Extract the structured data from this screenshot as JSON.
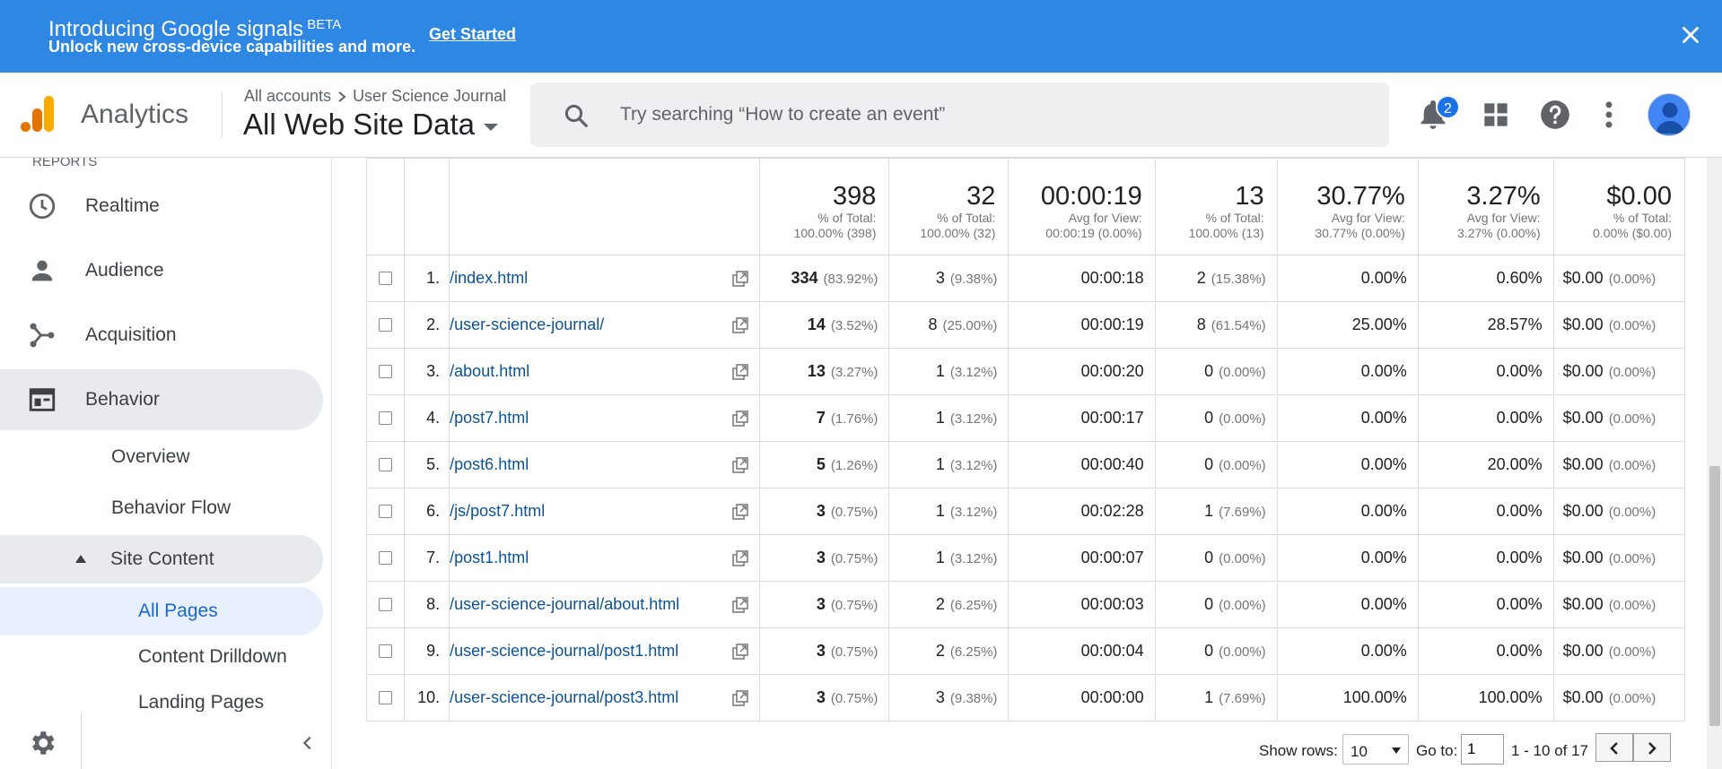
{
  "banner": {
    "title": "Introducing Google signals",
    "beta": "BETA",
    "subtitle": "Unlock new cross-device capabilities and more.",
    "cta": "Get Started"
  },
  "header": {
    "app_name": "Analytics",
    "breadcrumb_account": "All accounts",
    "breadcrumb_property": "User Science Journal",
    "view": "All Web Site Data",
    "search_placeholder": "Try searching “How to create an event”",
    "notification_count": "2"
  },
  "sidebar": {
    "section_label": "REPORTS",
    "items": [
      {
        "label": "Realtime",
        "icon": "clock-icon"
      },
      {
        "label": "Audience",
        "icon": "person-icon"
      },
      {
        "label": "Acquisition",
        "icon": "acquisition-icon"
      },
      {
        "label": "Behavior",
        "icon": "behavior-icon"
      }
    ],
    "behavior_sub": [
      "Overview",
      "Behavior Flow"
    ],
    "site_content": "Site Content",
    "site_content_items": [
      "All Pages",
      "Content Drilldown",
      "Landing Pages"
    ]
  },
  "totals": [
    {
      "big": "398",
      "line1": "% of Total:",
      "line2": "100.00% (398)"
    },
    {
      "big": "32",
      "line1": "% of Total:",
      "line2": "100.00% (32)"
    },
    {
      "big": "00:00:19",
      "line1": "Avg for View:",
      "line2": "00:00:19 (0.00%)"
    },
    {
      "big": "13",
      "line1": "% of Total:",
      "line2": "100.00% (13)"
    },
    {
      "big": "30.77%",
      "line1": "Avg for View:",
      "line2": "30.77% (0.00%)"
    },
    {
      "big": "3.27%",
      "line1": "Avg for View:",
      "line2": "3.27% (0.00%)"
    },
    {
      "big": "$0.00",
      "line1": "% of Total:",
      "line2": "0.00% ($0.00)"
    }
  ],
  "rows": [
    {
      "idx": "1.",
      "page": "/index.html",
      "pv": "334",
      "pv_pct": "(83.92%)",
      "upv": "3",
      "upv_pct": "(9.38%)",
      "time": "00:00:18",
      "ent": "2",
      "ent_pct": "(15.38%)",
      "bounce": "0.00%",
      "exit": "0.60%",
      "value": "$0.00",
      "value_pct": "(0.00%)"
    },
    {
      "idx": "2.",
      "page": "/user-science-journal/",
      "pv": "14",
      "pv_pct": "(3.52%)",
      "upv": "8",
      "upv_pct": "(25.00%)",
      "time": "00:00:19",
      "ent": "8",
      "ent_pct": "(61.54%)",
      "bounce": "25.00%",
      "exit": "28.57%",
      "value": "$0.00",
      "value_pct": "(0.00%)"
    },
    {
      "idx": "3.",
      "page": "/about.html",
      "pv": "13",
      "pv_pct": "(3.27%)",
      "upv": "1",
      "upv_pct": "(3.12%)",
      "time": "00:00:20",
      "ent": "0",
      "ent_pct": "(0.00%)",
      "bounce": "0.00%",
      "exit": "0.00%",
      "value": "$0.00",
      "value_pct": "(0.00%)"
    },
    {
      "idx": "4.",
      "page": "/post7.html",
      "pv": "7",
      "pv_pct": "(1.76%)",
      "upv": "1",
      "upv_pct": "(3.12%)",
      "time": "00:00:17",
      "ent": "0",
      "ent_pct": "(0.00%)",
      "bounce": "0.00%",
      "exit": "0.00%",
      "value": "$0.00",
      "value_pct": "(0.00%)"
    },
    {
      "idx": "5.",
      "page": "/post6.html",
      "pv": "5",
      "pv_pct": "(1.26%)",
      "upv": "1",
      "upv_pct": "(3.12%)",
      "time": "00:00:40",
      "ent": "0",
      "ent_pct": "(0.00%)",
      "bounce": "0.00%",
      "exit": "20.00%",
      "value": "$0.00",
      "value_pct": "(0.00%)"
    },
    {
      "idx": "6.",
      "page": "/js/post7.html",
      "pv": "3",
      "pv_pct": "(0.75%)",
      "upv": "1",
      "upv_pct": "(3.12%)",
      "time": "00:02:28",
      "ent": "1",
      "ent_pct": "(7.69%)",
      "bounce": "0.00%",
      "exit": "0.00%",
      "value": "$0.00",
      "value_pct": "(0.00%)"
    },
    {
      "idx": "7.",
      "page": "/post1.html",
      "pv": "3",
      "pv_pct": "(0.75%)",
      "upv": "1",
      "upv_pct": "(3.12%)",
      "time": "00:00:07",
      "ent": "0",
      "ent_pct": "(0.00%)",
      "bounce": "0.00%",
      "exit": "0.00%",
      "value": "$0.00",
      "value_pct": "(0.00%)"
    },
    {
      "idx": "8.",
      "page": "/user-science-journal/about.html",
      "pv": "3",
      "pv_pct": "(0.75%)",
      "upv": "2",
      "upv_pct": "(6.25%)",
      "time": "00:00:03",
      "ent": "0",
      "ent_pct": "(0.00%)",
      "bounce": "0.00%",
      "exit": "0.00%",
      "value": "$0.00",
      "value_pct": "(0.00%)"
    },
    {
      "idx": "9.",
      "page": "/user-science-journal/post1.html",
      "pv": "3",
      "pv_pct": "(0.75%)",
      "upv": "2",
      "upv_pct": "(6.25%)",
      "time": "00:00:04",
      "ent": "0",
      "ent_pct": "(0.00%)",
      "bounce": "0.00%",
      "exit": "0.00%",
      "value": "$0.00",
      "value_pct": "(0.00%)"
    },
    {
      "idx": "10.",
      "page": "/user-science-journal/post3.html",
      "pv": "3",
      "pv_pct": "(0.75%)",
      "upv": "3",
      "upv_pct": "(9.38%)",
      "time": "00:00:00",
      "ent": "1",
      "ent_pct": "(7.69%)",
      "bounce": "100.00%",
      "exit": "100.00%",
      "value": "$0.00",
      "value_pct": "(0.00%)"
    }
  ],
  "pager": {
    "show_rows_label": "Show rows:",
    "show_rows_value": "10",
    "goto_label": "Go to:",
    "goto_value": "1",
    "range": "1 - 10 of 17"
  },
  "colors": {
    "banner": "#2f87e4",
    "link": "#0b5394",
    "selected_nav": "#1967d2",
    "logo_orange": "#f9ab00",
    "logo_dark_orange": "#e37400"
  }
}
